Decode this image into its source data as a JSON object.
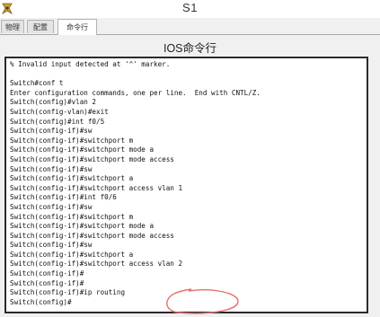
{
  "window": {
    "title": "S1",
    "icon": "device-icon"
  },
  "tabs": [
    {
      "label": "物理",
      "active": false
    },
    {
      "label": "配置",
      "active": false
    },
    {
      "label": "命令行",
      "active": true
    }
  ],
  "section_title": "IOS命令行",
  "console": {
    "lines": [
      "% Invalid input detected at '^' marker.",
      "",
      "Switch#conf t",
      "Enter configuration commands, one per line.  End with CNTL/Z.",
      "Switch(config)#vlan 2",
      "Switch(config-vlan)#exit",
      "Switch(config)#int f0/5",
      "Switch(config-if)#sw",
      "Switch(config-if)#switchport m",
      "Switch(config-if)#switchport mode a",
      "Switch(config-if)#switchport mode access",
      "Switch(config-if)#sw",
      "Switch(config-if)#switchport a",
      "Switch(config-if)#switchport access vlan 1",
      "Switch(config-if)#int f0/6",
      "Switch(config-if)#sw",
      "Switch(config-if)#switchport m",
      "Switch(config-if)#switchport mode a",
      "Switch(config-if)#switchport mode access",
      "Switch(config-if)#sw",
      "Switch(config-if)#switchport a",
      "Switch(config-if)#switchport access vlan 2",
      "Switch(config-if)#",
      "Switch(config-if)#",
      "Switch(config-if)#ip routing",
      "Switch(config)#"
    ],
    "highlight_color": "#e0736a"
  }
}
